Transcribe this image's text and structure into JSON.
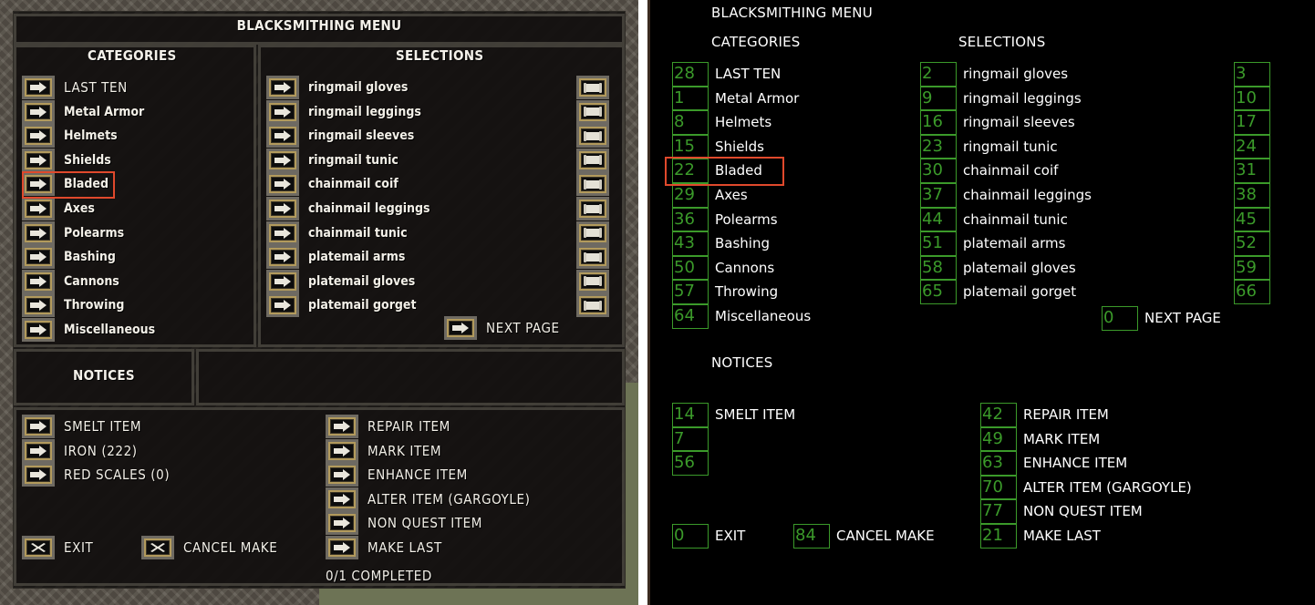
{
  "title": "BLACKSMITHING MENU",
  "categories_header": "CATEGORIES",
  "selections_header": "SELECTIONS",
  "notices_header": "NOTICES",
  "categories": [
    {
      "label": "LAST TEN",
      "id": "28"
    },
    {
      "label": "Metal Armor",
      "id": "1"
    },
    {
      "label": "Helmets",
      "id": "8"
    },
    {
      "label": "Shields",
      "id": "15"
    },
    {
      "label": "Bladed",
      "id": "22"
    },
    {
      "label": "Axes",
      "id": "29"
    },
    {
      "label": "Polearms",
      "id": "36"
    },
    {
      "label": "Bashing",
      "id": "43"
    },
    {
      "label": "Cannons",
      "id": "50"
    },
    {
      "label": "Throwing",
      "id": "57"
    },
    {
      "label": "Miscellaneous",
      "id": "64"
    }
  ],
  "selections": [
    {
      "label": "ringmail gloves",
      "id": "2",
      "info_id": "3"
    },
    {
      "label": "ringmail leggings",
      "id": "9",
      "info_id": "10"
    },
    {
      "label": "ringmail sleeves",
      "id": "16",
      "info_id": "17"
    },
    {
      "label": "ringmail tunic",
      "id": "23",
      "info_id": "24"
    },
    {
      "label": "chainmail coif",
      "id": "30",
      "info_id": "31"
    },
    {
      "label": "chainmail leggings",
      "id": "37",
      "info_id": "38"
    },
    {
      "label": "chainmail tunic",
      "id": "44",
      "info_id": "45"
    },
    {
      "label": "platemail arms",
      "id": "51",
      "info_id": "52"
    },
    {
      "label": "platemail gloves",
      "id": "58",
      "info_id": "59"
    },
    {
      "label": "platemail gorget",
      "id": "65",
      "info_id": "66"
    }
  ],
  "next_page": {
    "label": "NEXT PAGE",
    "id": "0"
  },
  "materials": [
    {
      "label": "SMELT ITEM",
      "id": "14"
    },
    {
      "label": "IRON (222)",
      "id": "7"
    },
    {
      "label": "RED SCALES (0)",
      "id": "56"
    }
  ],
  "actions": [
    {
      "label": "REPAIR ITEM",
      "id": "42"
    },
    {
      "label": "MARK ITEM",
      "id": "49"
    },
    {
      "label": "ENHANCE ITEM",
      "id": "63"
    },
    {
      "label": "ALTER ITEM (GARGOYLE)",
      "id": "70"
    },
    {
      "label": "NON QUEST ITEM",
      "id": "77"
    },
    {
      "label": "MAKE LAST",
      "id": "21"
    }
  ],
  "exit": {
    "label": "EXIT",
    "id": "0"
  },
  "cancel_make": {
    "label": "CANCEL MAKE",
    "id": "84"
  },
  "status": "0/1 COMPLETED",
  "highlighted_category": "Bladed",
  "colors": {
    "id_box": "#3b9a2a",
    "highlight": "#e0492c",
    "button_border": "#b29a5c"
  }
}
